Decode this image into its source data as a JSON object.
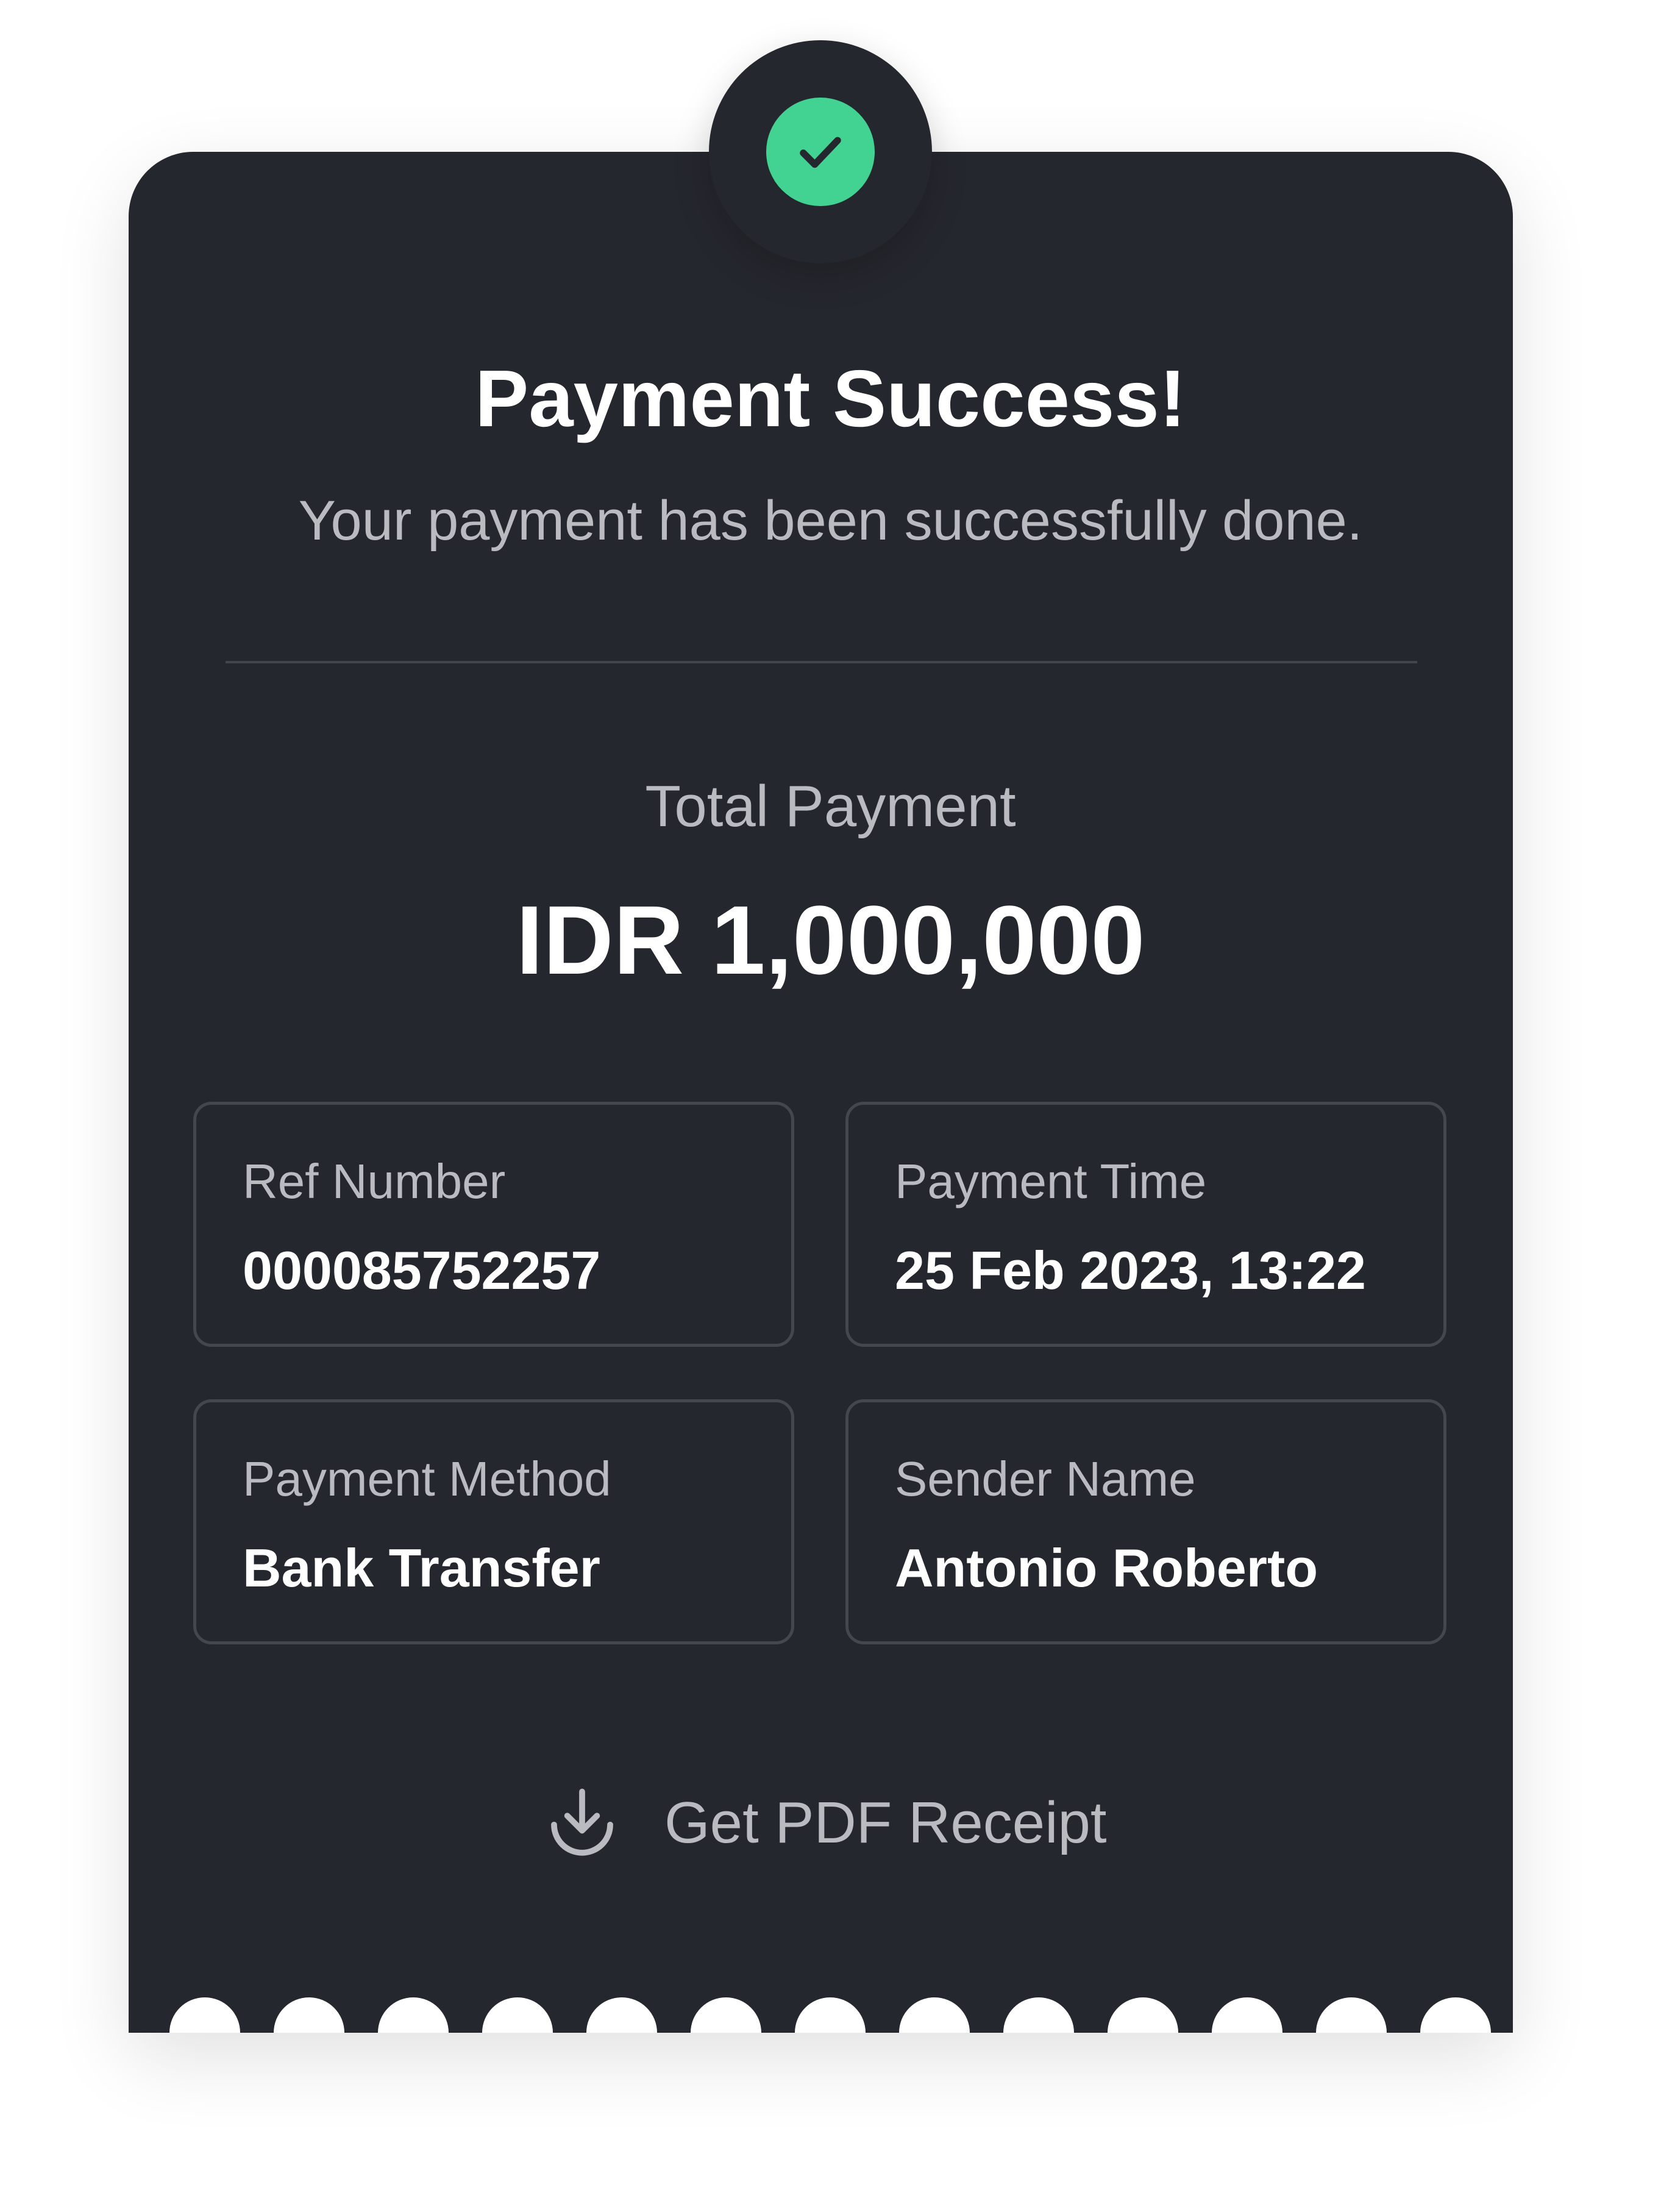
{
  "header": {
    "status_icon": "check-icon",
    "title": "Payment Success!",
    "subtitle": "Your payment has been successfully done."
  },
  "total": {
    "label": "Total Payment",
    "amount": "IDR 1,000,000"
  },
  "details": [
    {
      "label": "Ref Number",
      "value": "000085752257"
    },
    {
      "label": "Payment Time",
      "value": "25 Feb 2023, 13:22"
    },
    {
      "label": "Payment Method",
      "value": "Bank Transfer"
    },
    {
      "label": "Sender Name",
      "value": "Antonio Roberto"
    }
  ],
  "actions": {
    "receipt_icon": "download-icon",
    "receipt_label": "Get PDF Receipt"
  },
  "colors": {
    "card_background": "#25272e",
    "success_accent": "#42d392",
    "page_background": "#ffffff"
  }
}
